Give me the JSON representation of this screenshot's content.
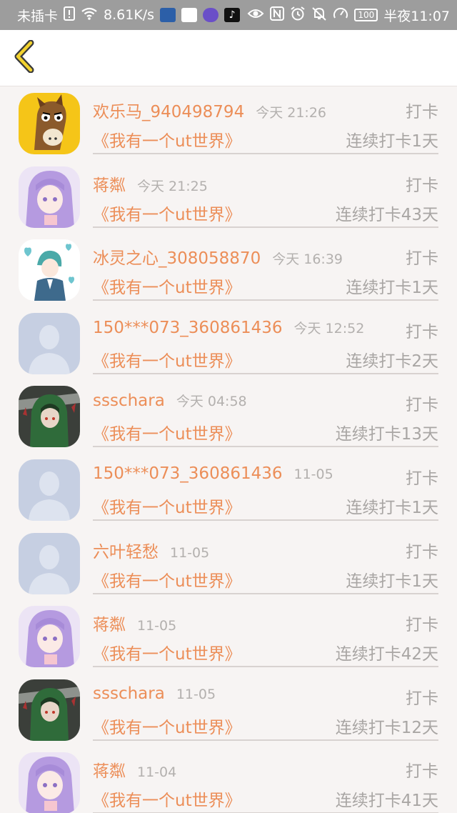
{
  "status_bar": {
    "carrier": "未插卡",
    "speed": "8.61K/s",
    "battery": "100",
    "time": "半夜11:07",
    "icons": [
      "sim-alert-icon",
      "wifi-icon",
      "app-icon-1",
      "app-icon-2",
      "app-icon-3",
      "tiktok-icon",
      "eye-icon",
      "nfc-icon",
      "alarm-icon",
      "mute-icon",
      "speedometer-icon"
    ]
  },
  "header": {
    "back_icon": "chevron-left-icon",
    "accent_color": "#f2d22e"
  },
  "colors": {
    "name": "#ec8e58",
    "muted": "#a9a6a4",
    "background": "#f7f4f3"
  },
  "entries": [
    {
      "name": "欢乐马_940498794",
      "time": "今天 21:26",
      "action": "打卡",
      "book": "《我有一个ut世界》",
      "streak": "连续打卡1天",
      "avatar": "horse-avatar"
    },
    {
      "name": "蒋粼",
      "time": "今天 21:25",
      "action": "打卡",
      "book": "《我有一个ut世界》",
      "streak": "连续打卡43天",
      "avatar": "anime-girl-purple-avatar"
    },
    {
      "name": "冰灵之心_308058870",
      "time": "今天 16:39",
      "action": "打卡",
      "book": "《我有一个ut世界》",
      "streak": "连续打卡1天",
      "avatar": "anime-boy-hearts-avatar"
    },
    {
      "name": "150***073_360861436",
      "time": "今天 12:52",
      "action": "打卡",
      "book": "《我有一个ut世界》",
      "streak": "连续打卡2天",
      "avatar": "default-user-avatar"
    },
    {
      "name": "ssschara",
      "time": "今天 04:58",
      "action": "打卡",
      "book": "《我有一个ut世界》",
      "streak": "连续打卡13天",
      "avatar": "green-hood-avatar"
    },
    {
      "name": "150***073_360861436",
      "time": "11-05",
      "action": "打卡",
      "book": "《我有一个ut世界》",
      "streak": "连续打卡1天",
      "avatar": "default-user-avatar"
    },
    {
      "name": "六叶轻愁",
      "time": "11-05",
      "action": "打卡",
      "book": "《我有一个ut世界》",
      "streak": "连续打卡1天",
      "avatar": "default-user-avatar"
    },
    {
      "name": "蒋粼",
      "time": "11-05",
      "action": "打卡",
      "book": "《我有一个ut世界》",
      "streak": "连续打卡42天",
      "avatar": "anime-girl-purple-avatar"
    },
    {
      "name": "ssschara",
      "time": "11-05",
      "action": "打卡",
      "book": "《我有一个ut世界》",
      "streak": "连续打卡12天",
      "avatar": "green-hood-avatar"
    },
    {
      "name": "蒋粼",
      "time": "11-04",
      "action": "打卡",
      "book": "《我有一个ut世界》",
      "streak": "连续打卡41天",
      "avatar": "anime-girl-purple-avatar"
    }
  ]
}
